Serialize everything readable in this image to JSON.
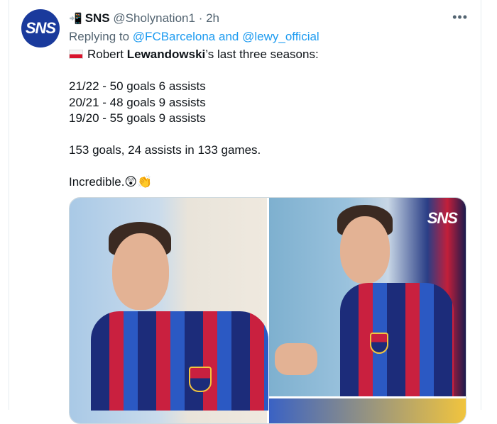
{
  "tweet": {
    "avatar_text": "SNS",
    "header_emoji": "📲",
    "name": "SNS",
    "handle": "@Sholynation1",
    "dot": "·",
    "time": "2h",
    "more": "•••",
    "reply_prefix": "Replying to",
    "reply_to_1": "@FCBarcelona",
    "reply_and": "and",
    "reply_to_2": "@lewy_official",
    "body": {
      "line1_pre": "Robert ",
      "line1_bold": "Lewandowski",
      "line1_post": "’s last three seasons:",
      "season1": "21/22 - 50 goals 6 assists",
      "season2": "20/21 - 48 goals 9 assists",
      "season3": "19/20 - 55 goals 9 assists",
      "summary": "153 goals, 24 assists in 133 games.",
      "closing": "Incredible.😲👏"
    },
    "media": {
      "watermark": "SNS"
    }
  },
  "colors": {
    "accent": "#1d9bf0",
    "secondary_text": "#536471",
    "avatar_bg": "#1a3a9c"
  }
}
